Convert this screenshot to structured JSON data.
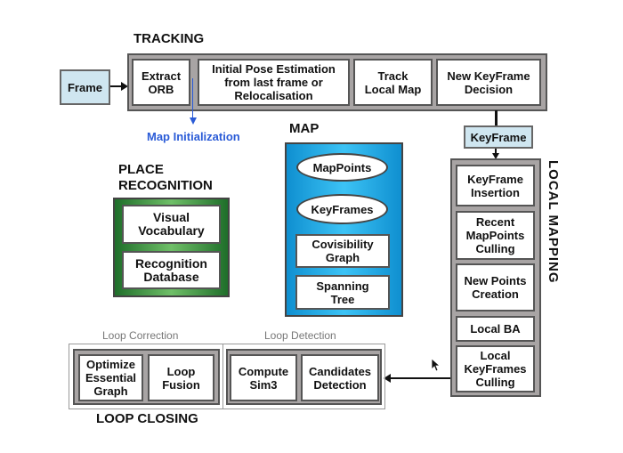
{
  "tracking": {
    "title": "TRACKING",
    "input": "Frame",
    "steps": [
      "Extract\nORB",
      "Initial Pose Estimation\nfrom last frame or\nRelocalisation",
      "Track\nLocal Map",
      "New KeyFrame\nDecision"
    ],
    "map_init": "Map Initialization",
    "map_init_color": "#2a5bd7"
  },
  "map": {
    "title": "MAP",
    "items": [
      "MapPoints",
      "KeyFrames",
      "Covisibility\nGraph",
      "Spanning\nTree"
    ],
    "color": "#1aa3e0"
  },
  "place_recognition": {
    "title": "PLACE\nRECOGNITION",
    "items": [
      "Visual\nVocabulary",
      "Recognition\nDatabase"
    ],
    "color": "#2e8b3a"
  },
  "keyframe": "KeyFrame",
  "local_mapping": {
    "title": "LOCAL MAPPING",
    "steps": [
      "KeyFrame\nInsertion",
      "Recent\nMapPoints\nCulling",
      "New Points\nCreation",
      "Local BA",
      "Local\nKeyFrames\nCulling"
    ]
  },
  "loop_closing": {
    "title": "LOOP CLOSING",
    "correction_label": "Loop Correction",
    "detection_label": "Loop Detection",
    "correction_steps": [
      "Optimize\nEssential\nGraph",
      "Loop\nFusion"
    ],
    "detection_steps": [
      "Compute\nSim3",
      "Candidates\nDetection"
    ]
  }
}
